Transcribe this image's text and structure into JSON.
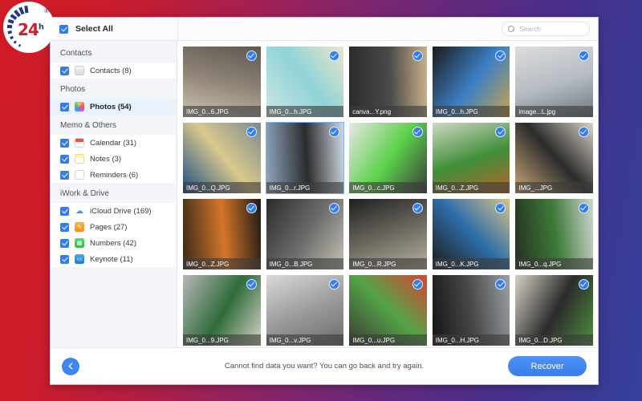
{
  "branding": {
    "logo_text": "24",
    "logo_sup": "h",
    "registered": "®"
  },
  "topbar": {
    "select_all_label": "Select All",
    "search_placeholder": "Search",
    "search_value": "",
    "search_icon": "search-icon"
  },
  "sidebar": {
    "groups": [
      {
        "title": "Contacts",
        "items": [
          {
            "label": "Contacts (8)",
            "icon": "contacts-icon",
            "checked": true,
            "selected": false
          }
        ]
      },
      {
        "title": "Photos",
        "items": [
          {
            "label": "Photos (54)",
            "icon": "photos-icon",
            "checked": true,
            "selected": true
          }
        ]
      },
      {
        "title": "Memo & Others",
        "items": [
          {
            "label": "Calendar (31)",
            "icon": "calendar-icon",
            "checked": true,
            "selected": false
          },
          {
            "label": "Notes (3)",
            "icon": "notes-icon",
            "checked": true,
            "selected": false
          },
          {
            "label": "Reminders (6)",
            "icon": "reminders-icon",
            "checked": true,
            "selected": false
          }
        ]
      },
      {
        "title": "iWork & Drive",
        "items": [
          {
            "label": "iCloud Drive (169)",
            "icon": "icloud-drive-icon",
            "checked": true,
            "selected": false
          },
          {
            "label": "Pages (27)",
            "icon": "pages-icon",
            "checked": true,
            "selected": false
          },
          {
            "label": "Numbers (42)",
            "icon": "numbers-icon",
            "checked": true,
            "selected": false
          },
          {
            "label": "Keynote (11)",
            "icon": "keynote-icon",
            "checked": true,
            "selected": false
          }
        ]
      }
    ]
  },
  "grid": {
    "columns": 5,
    "items": [
      {
        "filename": "IMG_0...6.JPG",
        "selected": true,
        "focused": false
      },
      {
        "filename": "IMG_0...h.JPG",
        "selected": true,
        "focused": false
      },
      {
        "filename": "canva...Y.png",
        "selected": true,
        "focused": false
      },
      {
        "filename": "IMG_0...h.JPG",
        "selected": true,
        "focused": false
      },
      {
        "filename": "image...L.jpg",
        "selected": true,
        "focused": false
      },
      {
        "filename": "IMG_0...Q.JPG",
        "selected": true,
        "focused": false
      },
      {
        "filename": "IMG_0...r.JPG",
        "selected": true,
        "focused": true
      },
      {
        "filename": "IMG_0...c.JPG",
        "selected": true,
        "focused": false
      },
      {
        "filename": "IMG_0...Z.JPG",
        "selected": true,
        "focused": false
      },
      {
        "filename": "IMG_...JPG",
        "selected": true,
        "focused": false
      },
      {
        "filename": "IMG_0...Z.JPG",
        "selected": true,
        "focused": false
      },
      {
        "filename": "IMG_0...B.JPG",
        "selected": true,
        "focused": false
      },
      {
        "filename": "IMG_0...R.JPG",
        "selected": true,
        "focused": false
      },
      {
        "filename": "IMG_0...K.JPG",
        "selected": true,
        "focused": false
      },
      {
        "filename": "IMG_0...q.JPG",
        "selected": true,
        "focused": false
      },
      {
        "filename": "IMG_0...9.JPG",
        "selected": true,
        "focused": false
      },
      {
        "filename": "IMG_0...v.JPG",
        "selected": true,
        "focused": false
      },
      {
        "filename": "IMG_0...u.JPG",
        "selected": true,
        "focused": false
      },
      {
        "filename": "IMG_0...H.JPG",
        "selected": true,
        "focused": false
      },
      {
        "filename": "IMG_0...D.JPG",
        "selected": true,
        "focused": false
      }
    ]
  },
  "footer": {
    "back_icon": "arrow-left-icon",
    "hint": "Cannot find data you want? You can go back and try again.",
    "recover_label": "Recover"
  },
  "colors": {
    "accent": "#2f7cf6",
    "recover_button": "#3f86f2",
    "sidebar_bg": "#f4f5f8",
    "selected_row": "#e9f1fd",
    "bg_gradient_start": "#d01b26",
    "bg_gradient_end": "#35409c"
  }
}
